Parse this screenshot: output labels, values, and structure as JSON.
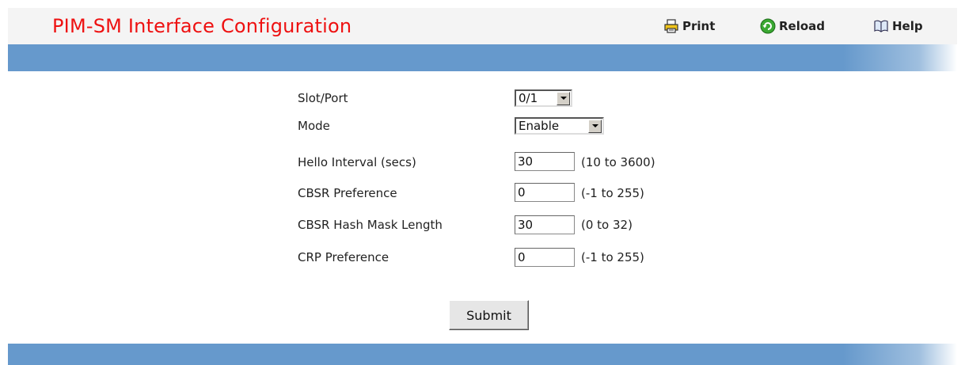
{
  "header": {
    "title": "PIM-SM Interface Configuration",
    "print_label": "Print",
    "reload_label": "Reload",
    "help_label": "Help"
  },
  "colors": {
    "title": "#ee1111",
    "bar": "#6699cc",
    "header_bg": "#f4f4f4"
  },
  "form": {
    "slot_port": {
      "label": "Slot/Port",
      "value": "0/1"
    },
    "mode": {
      "label": "Mode",
      "value": "Enable"
    },
    "hello_interval": {
      "label": "Hello Interval (secs)",
      "value": "30",
      "hint": "(10 to 3600)"
    },
    "cbsr_preference": {
      "label": "CBSR Preference",
      "value": "0",
      "hint": "(-1 to 255)"
    },
    "cbsr_hash_mask_length": {
      "label": "CBSR Hash Mask Length",
      "value": "30",
      "hint": "(0 to 32)"
    },
    "crp_preference": {
      "label": "CRP Preference",
      "value": "0",
      "hint": "(-1 to 255)"
    },
    "submit_label": "Submit"
  },
  "icons": {
    "print": "printer-icon",
    "reload": "reload-icon",
    "help": "book-icon"
  }
}
